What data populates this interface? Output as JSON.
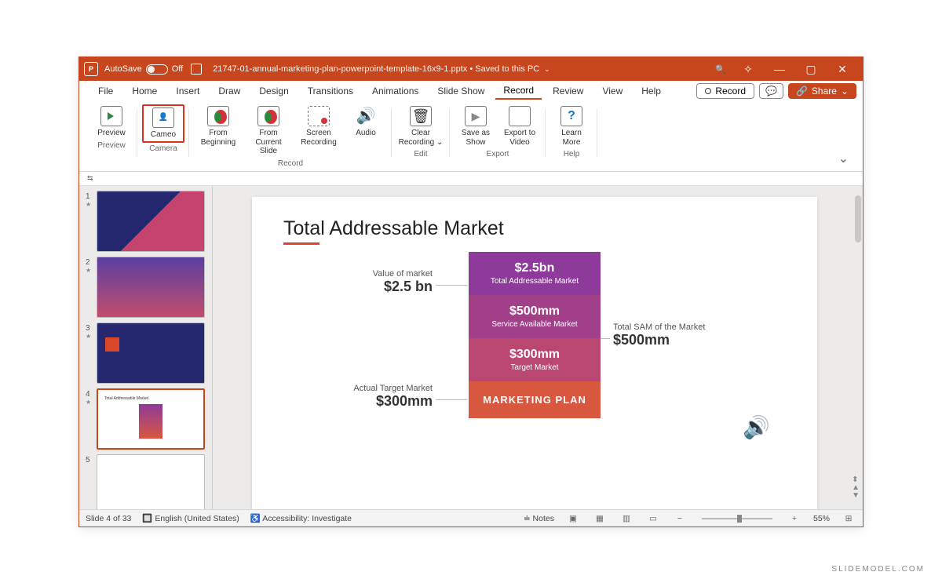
{
  "titlebar": {
    "autosave_label": "AutoSave",
    "autosave_state": "Off",
    "filename": "21747-01-annual-marketing-plan-powerpoint-template-16x9-1.pptx",
    "save_status": "Saved to this PC"
  },
  "menu": {
    "tabs": [
      "File",
      "Home",
      "Insert",
      "Draw",
      "Design",
      "Transitions",
      "Animations",
      "Slide Show",
      "Record",
      "Review",
      "View",
      "Help"
    ],
    "active": "Record",
    "record_btn": "Record",
    "share_btn": "Share"
  },
  "ribbon": {
    "groups": [
      {
        "label": "Preview",
        "items": [
          {
            "label": "Preview"
          }
        ]
      },
      {
        "label": "Camera",
        "items": [
          {
            "label": "Cameo",
            "highlighted": true
          }
        ]
      },
      {
        "label": "Record",
        "items": [
          {
            "label": "From Beginning"
          },
          {
            "label": "From Current Slide"
          },
          {
            "label": "Screen Recording"
          },
          {
            "label": "Audio"
          }
        ]
      },
      {
        "label": "Edit",
        "items": [
          {
            "label": "Clear Recording ⌄"
          }
        ]
      },
      {
        "label": "Export",
        "items": [
          {
            "label": "Save as Show"
          },
          {
            "label": "Export to Video"
          }
        ]
      },
      {
        "label": "Help",
        "items": [
          {
            "label": "Learn More"
          }
        ]
      }
    ]
  },
  "thumbs": {
    "count": 5,
    "selected": 4
  },
  "slide": {
    "title": "Total Addressable Market",
    "left1_label": "Value of market",
    "left1_value": "$2.5 bn",
    "left2_label": "Actual Target Market",
    "left2_value": "$300mm",
    "right1_label": "Total SAM of the Market",
    "right1_value": "$500mm",
    "seg1_value": "$2.5bn",
    "seg1_label": "Total Addressable Market",
    "seg2_value": "$500mm",
    "seg2_label": "Service Available Market",
    "seg3_value": "$300mm",
    "seg3_label": "Target Market",
    "seg4_label": "MARKETING PLAN"
  },
  "status": {
    "slide_pos": "Slide 4 of 33",
    "language": "English (United States)",
    "accessibility": "Accessibility: Investigate",
    "notes": "Notes",
    "zoom": "55%"
  },
  "watermark": "SLIDEMODEL.COM"
}
